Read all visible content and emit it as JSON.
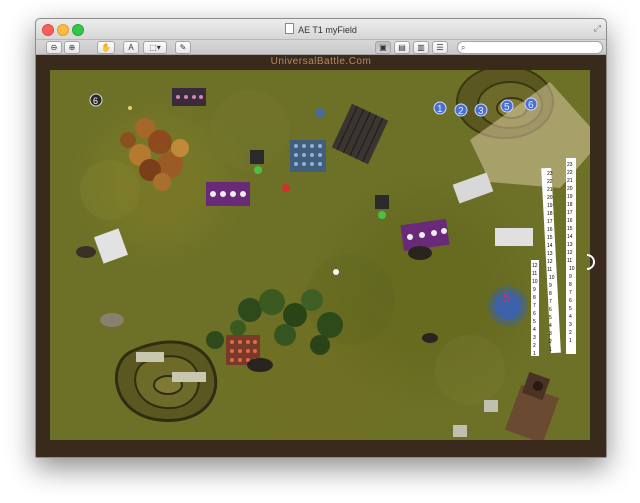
{
  "window": {
    "title": "AE T1 myField"
  },
  "toolbar": {
    "buttons": [
      {
        "name": "zoom-out-button",
        "icon": "zoom-out-icon",
        "glyph": "⊖"
      },
      {
        "name": "zoom-in-button",
        "icon": "zoom-in-icon",
        "glyph": "⊕"
      },
      {
        "name": "pan-hand-button",
        "icon": "hand-icon",
        "glyph": "✋"
      },
      {
        "name": "text-tool-button",
        "icon": "text-icon",
        "glyph": "A"
      },
      {
        "name": "selection-tool-button",
        "icon": "selection-icon",
        "glyph": "⬚▾"
      },
      {
        "name": "edit-pencil-button",
        "icon": "pencil-icon",
        "glyph": "✎"
      }
    ],
    "view_buttons": [
      {
        "name": "view-single-button",
        "glyph": "▣",
        "active": true
      },
      {
        "name": "view-sidebar-button",
        "glyph": "▤",
        "active": false
      },
      {
        "name": "view-two-page-button",
        "glyph": "▥",
        "active": false
      },
      {
        "name": "view-list-button",
        "glyph": "☰",
        "active": false
      }
    ],
    "search": {
      "placeholder": "",
      "icon": "search-icon",
      "glyph": "🔍"
    }
  },
  "board": {
    "watermark": "UniversalBattle.Com",
    "counters": [
      "1",
      "2",
      "3",
      "5",
      "6"
    ],
    "objective_marker": "5",
    "corner_token": "6",
    "turn_track_left": [
      "23",
      "22",
      "21",
      "20",
      "19",
      "18",
      "17",
      "16",
      "15",
      "14",
      "13",
      "12",
      "11",
      "10",
      "9",
      "8",
      "7",
      "6",
      "5",
      "4",
      "3",
      "2",
      "1"
    ],
    "turn_track_right": [
      "23",
      "22",
      "21",
      "20",
      "19",
      "18",
      "17",
      "16",
      "15",
      "14",
      "13",
      "12",
      "11",
      "10",
      "9",
      "8",
      "7",
      "6",
      "5",
      "4",
      "3",
      "2",
      "1"
    ],
    "short_track": [
      "12",
      "11",
      "10",
      "9",
      "8",
      "7",
      "6",
      "5",
      "4",
      "3",
      "2",
      "1"
    ]
  },
  "colors": {
    "grass": "#6c7127",
    "frame": "#3a2a1c",
    "counter_blue": "#4a6fd0",
    "unit_purple": "#6a2a7a",
    "objective_blue": "#2f5fd6"
  }
}
